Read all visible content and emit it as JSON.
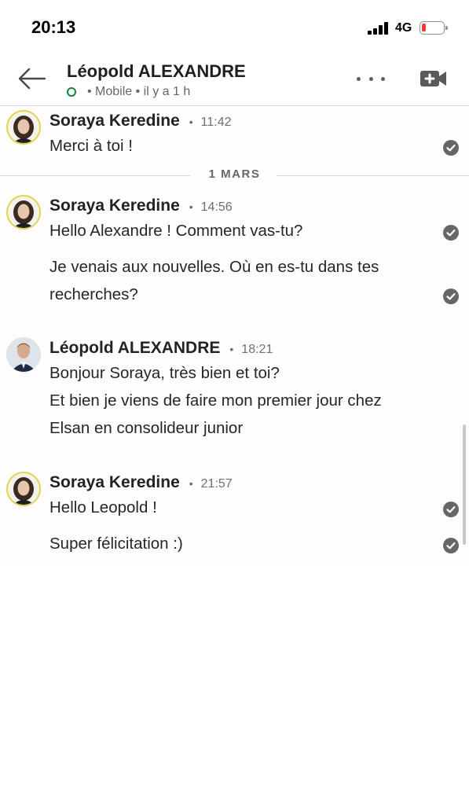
{
  "status_bar": {
    "time": "20:13",
    "network": "4G"
  },
  "header": {
    "contact_name": "Léopold ALEXANDRE",
    "presence": "• Mobile • il y a 1 h"
  },
  "thread": {
    "date_divider": "1 MARS",
    "groups": [
      {
        "sender": "Soraya Keredine",
        "time": "11:42",
        "messages": [
          "Merci à toi !"
        ]
      },
      {
        "sender": "Soraya Keredine",
        "time": "14:56",
        "messages": [
          "Hello Alexandre ! Comment vas-tu?",
          "Je venais aux nouvelles. Où en es-tu dans tes",
          "recherches?"
        ]
      },
      {
        "sender": "Léopold ALEXANDRE",
        "time": "18:21",
        "messages": [
          "Bonjour Soraya, très bien et toi?",
          "Et bien je viens de faire mon premier jour chez",
          "Elsan en consolideur junior"
        ]
      },
      {
        "sender": "Soraya Keredine",
        "time": "21:57",
        "messages": [
          "Hello Leopold !",
          "Super félicitation :)"
        ]
      }
    ]
  },
  "icons": [
    "back-arrow-icon",
    "more-options-icon",
    "video-call-icon",
    "read-receipt-icon"
  ],
  "colors": {
    "online": "#12833b",
    "battery_low": "#f03a2e",
    "avatar_ring": "#e6d247"
  }
}
